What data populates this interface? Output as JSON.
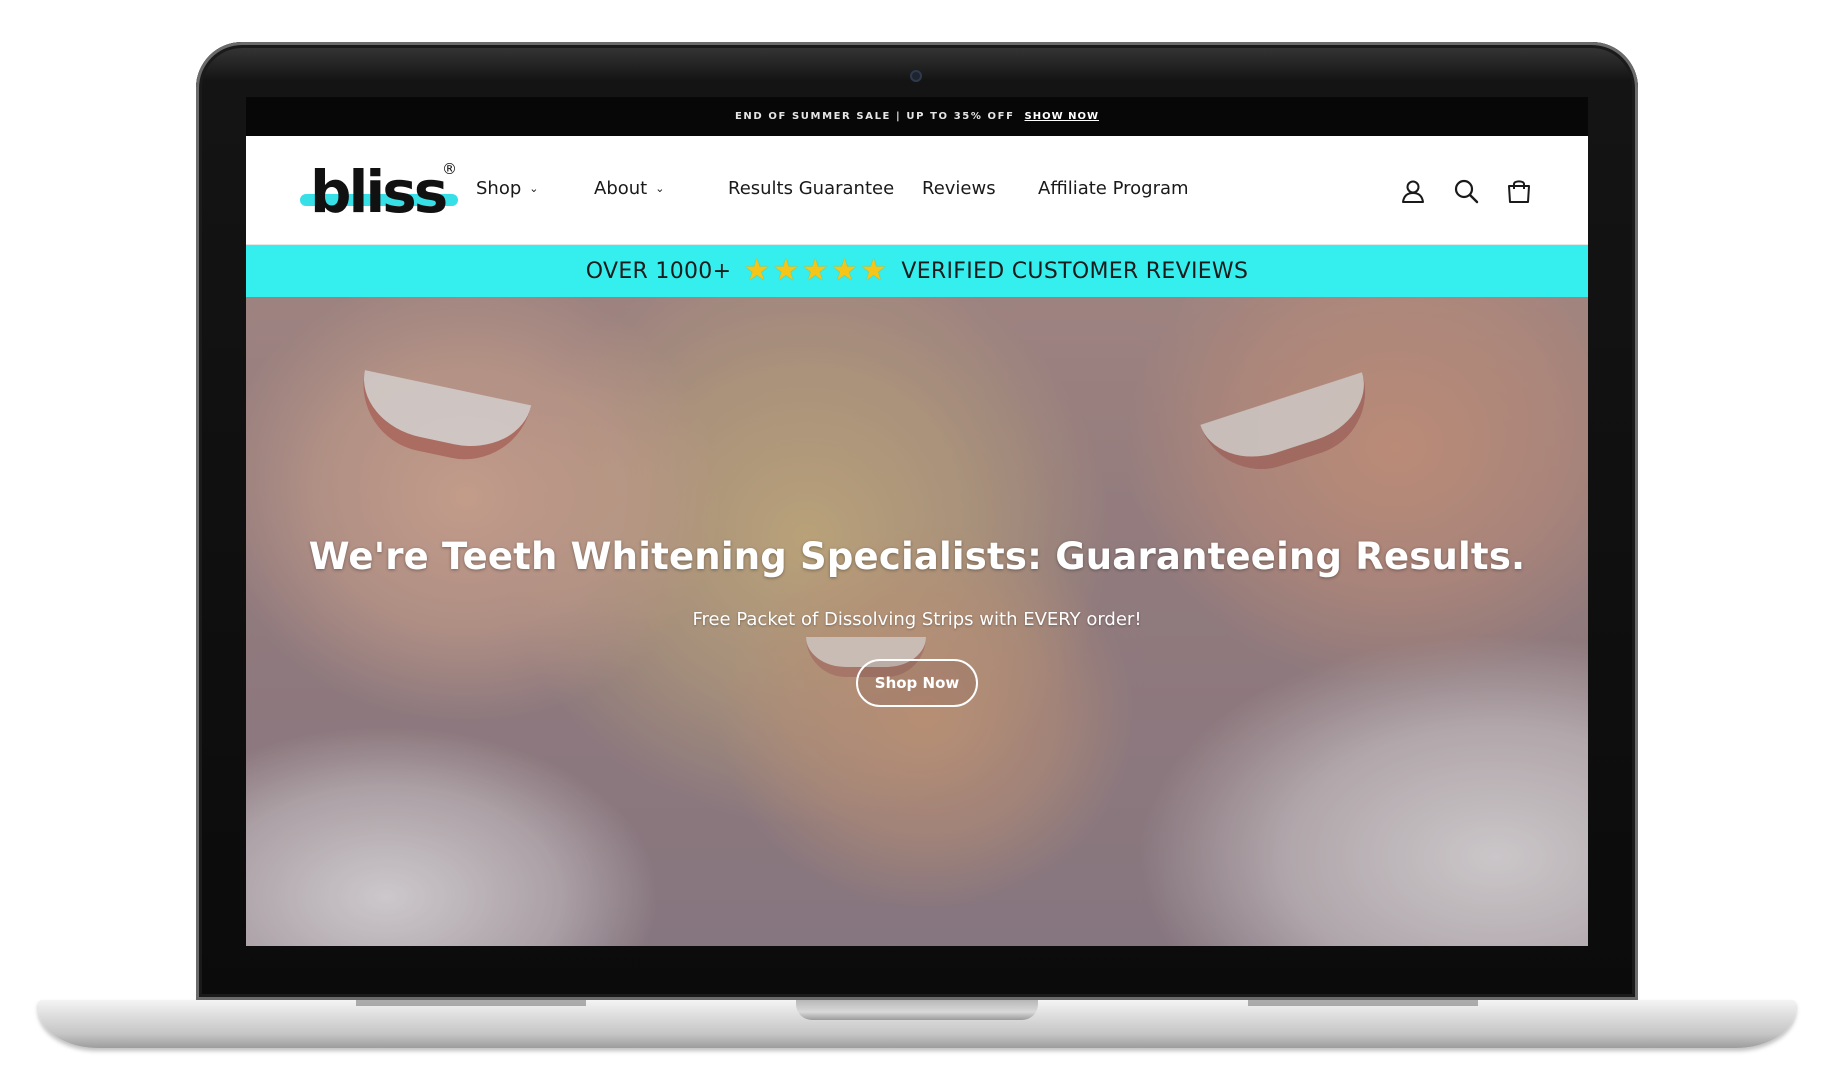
{
  "announcement": {
    "text": "END OF SUMMER SALE | UP TO 35% OFF",
    "link_label": "SHOW NOW"
  },
  "brand": {
    "name": "bliss",
    "registered_mark": "®",
    "accent_color": "#36e0e6"
  },
  "nav": {
    "items": [
      {
        "label": "Shop",
        "has_dropdown": true
      },
      {
        "label": "About",
        "has_dropdown": true
      },
      {
        "label": "Results Guarantee",
        "has_dropdown": false
      },
      {
        "label": "Reviews",
        "has_dropdown": false
      },
      {
        "label": "Affiliate Program",
        "has_dropdown": false
      }
    ],
    "icons": [
      "account-icon",
      "search-icon",
      "cart-icon"
    ]
  },
  "reviews_bar": {
    "prefix": "OVER 1000+",
    "suffix": "VERIFIED CUSTOMER REVIEWS",
    "rating": 5,
    "background": "#35eeee",
    "star_color": "#f5c518"
  },
  "hero": {
    "headline": "We're Teeth Whitening Specialists: Guaranteeing Results.",
    "subheadline": "Free Packet of Dissolving Strips with EVERY order!",
    "cta_label": "Shop Now"
  }
}
